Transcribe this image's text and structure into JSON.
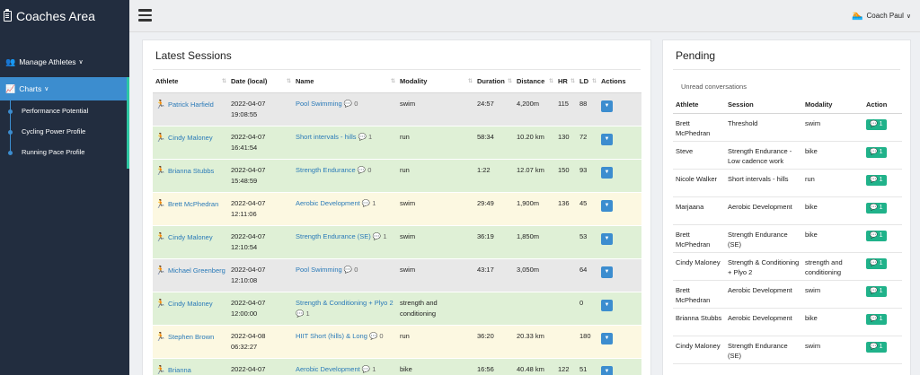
{
  "sidebar": {
    "brand": "Coaches Area",
    "manage_label": "Manage Athletes",
    "charts_label": "Charts",
    "sub_items": [
      "Performance Potential",
      "Cycling Power Profile",
      "Running Pace Profile"
    ]
  },
  "topbar": {
    "user_label": "Coach Paul"
  },
  "sessions": {
    "title": "Latest Sessions",
    "headers": [
      "Athlete",
      "Date (local)",
      "Name",
      "Modality",
      "Duration",
      "Distance",
      "HR",
      "LD",
      "Actions"
    ],
    "rows": [
      {
        "athlete": "Patrick Harfield",
        "date": "2022-04-07",
        "time": "19:08:55",
        "name": "Pool Swimming",
        "comments": "0",
        "modality": "swim",
        "duration": "24:57",
        "distance": "4,200m",
        "hr": "115",
        "ld": "88",
        "color": "grey"
      },
      {
        "athlete": "Cindy Maloney",
        "date": "2022-04-07",
        "time": "16:41:54",
        "name": "Short intervals - hills",
        "comments": "1",
        "modality": "run",
        "duration": "58:34",
        "distance": "10.20 km",
        "hr": "130",
        "ld": "72",
        "color": "green"
      },
      {
        "athlete": "Brianna Stubbs",
        "date": "2022-04-07",
        "time": "15:48:59",
        "name": "Strength Endurance",
        "comments": "0",
        "modality": "run",
        "duration": "1:22",
        "distance": "12.07 km",
        "hr": "150",
        "ld": "93",
        "color": "green"
      },
      {
        "athlete": "Brett McPhedran",
        "date": "2022-04-07",
        "time": "12:11:06",
        "name": "Aerobic Development",
        "comments": "1",
        "modality": "swim",
        "duration": "29:49",
        "distance": "1,900m",
        "hr": "136",
        "ld": "45",
        "color": "yellow"
      },
      {
        "athlete": "Cindy Maloney",
        "date": "2022-04-07",
        "time": "12:10:54",
        "name": "Strength Endurance (SE)",
        "comments": "1",
        "modality": "swim",
        "duration": "36:19",
        "distance": "1,850m",
        "hr": "",
        "ld": "53",
        "color": "green"
      },
      {
        "athlete": "Michael Greenberg",
        "date": "2022-04-07",
        "time": "12:10:08",
        "name": "Pool Swimming",
        "comments": "0",
        "modality": "swim",
        "duration": "43:17",
        "distance": "3,050m",
        "hr": "",
        "ld": "64",
        "color": "grey"
      },
      {
        "athlete": "Cindy Maloney",
        "date": "2022-04-07",
        "time": "12:00:00",
        "name": "Strength & Conditioning + Plyo 2",
        "comments": "1",
        "modality": "strength and conditioning",
        "duration": "",
        "distance": "",
        "hr": "",
        "ld": "0",
        "color": "green"
      },
      {
        "athlete": "Stephen Brown",
        "date": "2022-04-08",
        "time": "06:32:27",
        "name": "HIIT Short (hills) & Long",
        "comments": "0",
        "modality": "run",
        "duration": "36:20",
        "distance": "20.33 km",
        "hr": "",
        "ld": "180",
        "color": "yellow"
      },
      {
        "athlete": "Brianna",
        "date": "2022-04-07",
        "time": "",
        "name": "Aerobic Development",
        "comments": "1",
        "modality": "bike",
        "duration": "16:56",
        "distance": "40.48 km",
        "hr": "122",
        "ld": "51",
        "color": "green"
      }
    ]
  },
  "pending": {
    "title": "Pending",
    "subtitle": "Unread conversations",
    "headers": [
      "Athlete",
      "Session",
      "Modality",
      "Action"
    ],
    "rows": [
      {
        "athlete": "Brett McPhedran",
        "session": "Threshold",
        "modality": "swim",
        "count": "1"
      },
      {
        "athlete": "Steve",
        "session": "Strength Endurance - Low cadence work",
        "modality": "bike",
        "count": "1"
      },
      {
        "athlete": "Nicole Walker",
        "session": "Short intervals - hills",
        "modality": "run",
        "count": "1"
      },
      {
        "athlete": "Marjaana",
        "session": "Aerobic Development",
        "modality": "bike",
        "count": "1"
      },
      {
        "athlete": "Brett McPhedran",
        "session": "Strength Endurance (SE)",
        "modality": "bike",
        "count": "1"
      },
      {
        "athlete": "Cindy Maloney",
        "session": "Strength & Conditioning + Plyo 2",
        "modality": "strength and conditioning",
        "count": "1"
      },
      {
        "athlete": "Brett McPhedran",
        "session": "Aerobic Development",
        "modality": "swim",
        "count": "1"
      },
      {
        "athlete": "Brianna Stubbs",
        "session": "Aerobic Development",
        "modality": "bike",
        "count": "1"
      },
      {
        "athlete": "Cindy Maloney",
        "session": "Strength Endurance (SE)",
        "modality": "swim",
        "count": "1"
      }
    ]
  }
}
